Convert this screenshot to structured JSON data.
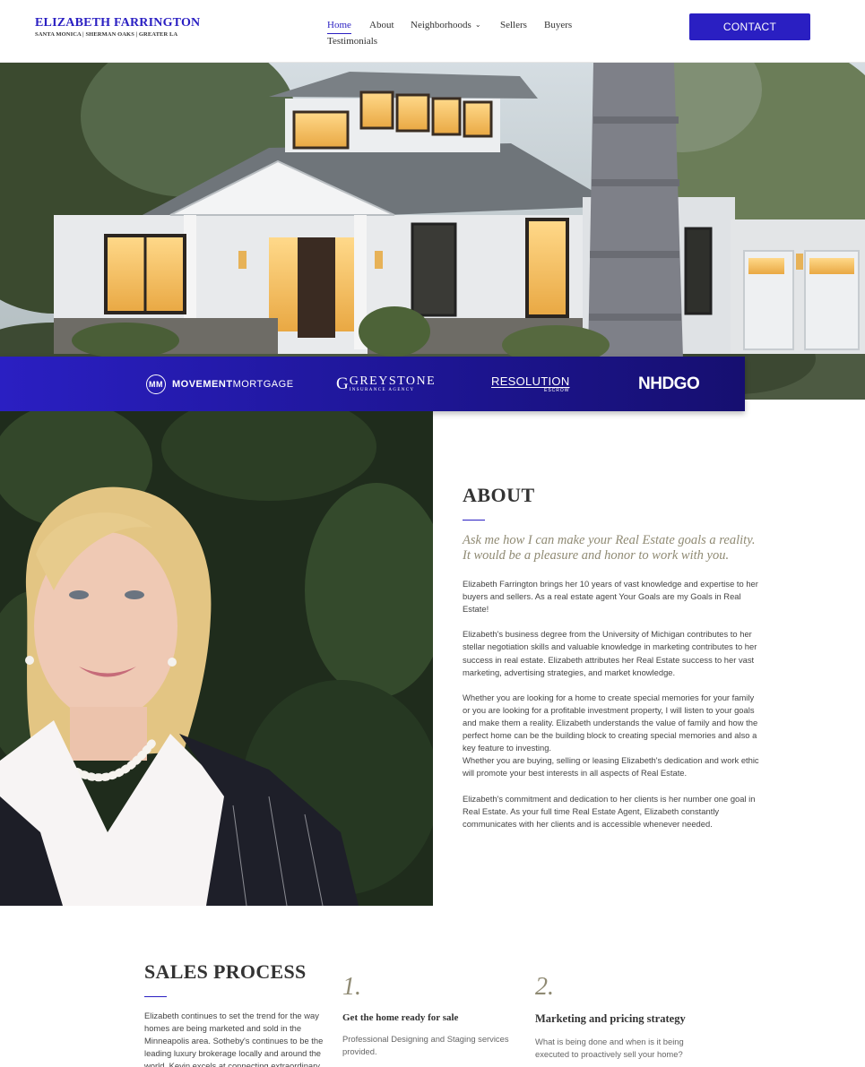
{
  "brand": {
    "name": "ELIZABETH FARRINGTON",
    "tagline": "SANTA MONICA | SHERMAN OAKS | GREATER LA"
  },
  "nav": {
    "items": [
      {
        "label": "Home",
        "active": true
      },
      {
        "label": "About"
      },
      {
        "label": "Neighborhoods",
        "has_dropdown": true
      },
      {
        "label": "Sellers"
      },
      {
        "label": "Buyers"
      },
      {
        "label": "Testimonials"
      }
    ],
    "contact_label": "CONTACT"
  },
  "colors": {
    "accent": "#2a1fc2",
    "quote": "#8f8a73"
  },
  "partners": {
    "movement": {
      "mark": "MM",
      "bold": "MOVEMENT",
      "light": "MORTGAGE"
    },
    "greystone": {
      "mark": "G",
      "name": "GREYSTONE",
      "sub": "INSURANCE AGENCY"
    },
    "resolution": {
      "name": "RESOLUTION",
      "sub": "ESCROW"
    },
    "nhdgo": {
      "name": "NHDGO"
    }
  },
  "about": {
    "title": "ABOUT",
    "quote": "Ask me how I can make your Real Estate goals a reality. It would be a pleasure and honor to work with you.",
    "p1": "Elizabeth Farrington brings her 10 years of vast knowledge and expertise to her buyers and sellers. As a real estate agent Your Goals are my Goals in Real Estate!",
    "p2": "Elizabeth's business degree from the University of Michigan contributes to her stellar negotiation skills and valuable knowledge in marketing contributes to her success in real estate. Elizabeth attributes her Real Estate success to her vast marketing, advertising strategies, and market knowledge.",
    "p3": "Whether you are looking for a home to create special memories for your family or you are looking for a profitable investment property, I will listen to your goals and make them a reality.  Elizabeth understands the value of family and how the perfect home can be the building block to creating special memories and also a key feature to investing.",
    "p4": "Whether you are buying, selling or leasing Elizabeth's dedication and work ethic will promote your best interests in all aspects of Real Estate.",
    "p5": "Elizabeth's commitment and dedication to her clients is her number one goal in Real Estate. As your full time Real Estate Agent, Elizabeth constantly communicates with her clients and is accessible whenever needed."
  },
  "sales": {
    "title": "SALES PROCESS",
    "body": "Elizabeth continues to set the trend for the way homes are being marketed and sold in the Minneapolis area. Sotheby's continues to be the leading luxury brokerage locally and around the world. Kevin excels at connecting extraordinary",
    "steps": [
      {
        "num": "1.",
        "title": "Get the home ready for sale",
        "desc": "Professional Designing and Staging services provided."
      },
      {
        "num": "2.",
        "title": "Marketing and pricing strategy",
        "desc": "What is being done and when is it being executed to proactively sell your home?"
      }
    ]
  }
}
